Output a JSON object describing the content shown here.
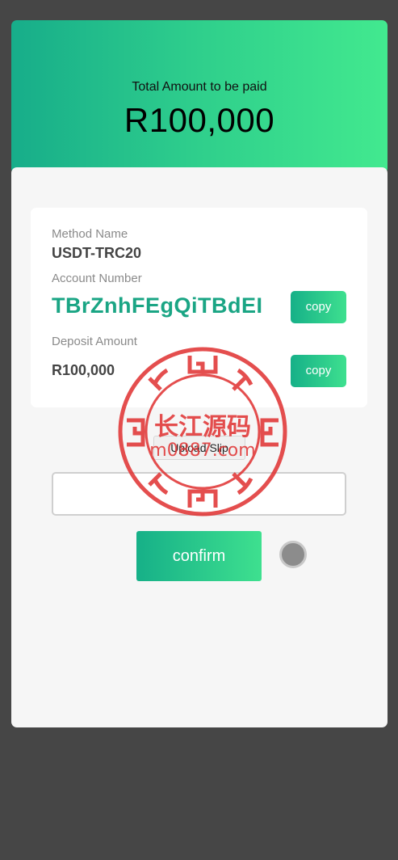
{
  "header": {
    "total_label": "Total Amount to be paid",
    "total_amount": "R100,000"
  },
  "payment": {
    "method_label": "Method Name",
    "method_value": "USDT-TRC20",
    "account_label": "Account Number",
    "account_value": "TBrZnhFEgQiTBdEI",
    "amount_label": "Deposit Amount",
    "amount_value": "R100,000",
    "copy_label": "copy"
  },
  "upload": {
    "button_label": "Upload Slip"
  },
  "actions": {
    "confirm_label": "confirm"
  },
  "watermark": {
    "title": "长江源码",
    "url": "m0887.com"
  },
  "colors": {
    "accent_start": "#16b088",
    "accent_end": "#42e98f",
    "account_text": "#1aa584",
    "watermark_red": "#e03030"
  }
}
